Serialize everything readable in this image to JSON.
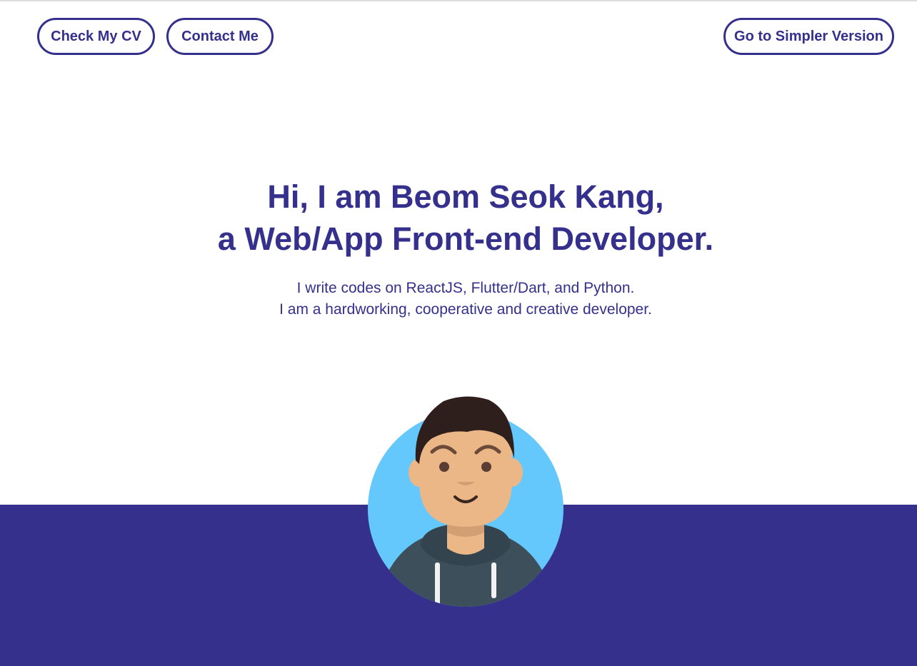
{
  "nav": {
    "cv_label": "Check My CV",
    "contact_label": "Contact Me",
    "simpler_label": "Go to Simpler Version"
  },
  "hero": {
    "title_line1": "Hi, I am Beom Seok Kang,",
    "title_line2": "a Web/App Front-end Developer.",
    "subtitle_line1": "I write codes on ReactJS, Flutter/Dart, and Python.",
    "subtitle_line2": "I am a hardworking, cooperative and creative developer."
  },
  "avatar": {
    "icon": "developer-avatar-icon"
  },
  "colors": {
    "brand": "#34308c",
    "avatar_background": "#64c8fc",
    "skin": "#ebb787",
    "hair": "#2e1f1c",
    "hoodie": "#3e4f5c"
  }
}
